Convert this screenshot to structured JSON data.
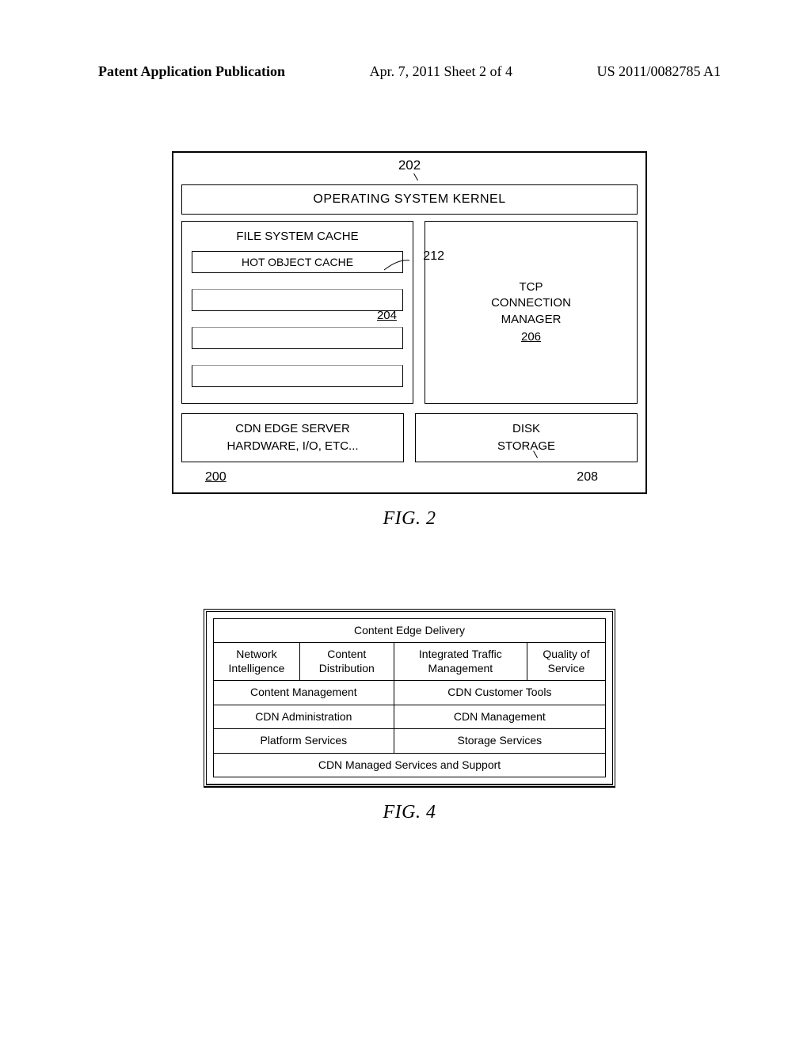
{
  "header": {
    "left": "Patent Application Publication",
    "center": "Apr. 7, 2011  Sheet 2 of 4",
    "right": "US 2011/0082785 A1"
  },
  "fig2": {
    "caption": "FIG. 2",
    "callout_202": "202",
    "os_kernel": "OPERATING SYSTEM KERNEL",
    "fsc_title": "FILE SYSTEM CACHE",
    "hot_object_cache": "HOT OBJECT CACHE",
    "callout_212": "212",
    "ref_204": "204",
    "tcp_l1": "TCP",
    "tcp_l2": "CONNECTION",
    "tcp_l3": "MANAGER",
    "ref_206": "206",
    "hw_l1": "CDN EDGE SERVER",
    "hw_l2": "HARDWARE, I/O, ETC...",
    "disk_l1": "DISK",
    "disk_l2": "STORAGE",
    "ref_200": "200",
    "ref_208": "208"
  },
  "fig4": {
    "caption": "FIG. 4",
    "r1c1": "Content Edge Delivery",
    "r2c1": "Network Intelligence",
    "r2c2": "Content Distribution",
    "r2c3": "Integrated Traffic Management",
    "r2c4": "Quality of Service",
    "r3c1": "Content Management",
    "r3c2": "CDN Customer Tools",
    "r4c1": "CDN Administration",
    "r4c2": "CDN Management",
    "r5c1": "Platform Services",
    "r5c2": "Storage Services",
    "r6c1": "CDN Managed Services and Support"
  },
  "chart_data": [
    {
      "type": "diagram",
      "title": "FIG. 2",
      "description": "Block diagram of CDN edge server architecture",
      "blocks": [
        {
          "id": "202",
          "label": "OPERATING SYSTEM KERNEL"
        },
        {
          "id": "204",
          "label": "FILE SYSTEM CACHE",
          "contains": [
            {
              "id": "212",
              "label": "HOT OBJECT CACHE"
            }
          ]
        },
        {
          "id": "206",
          "label": "TCP CONNECTION MANAGER"
        },
        {
          "id": "200",
          "label": "CDN EDGE SERVER HARDWARE, I/O, ETC..."
        },
        {
          "id": "208",
          "label": "DISK STORAGE"
        }
      ]
    },
    {
      "type": "table",
      "title": "FIG. 4",
      "description": "CDN layered services table",
      "rows": [
        [
          "Content Edge Delivery"
        ],
        [
          "Network Intelligence",
          "Content Distribution",
          "Integrated Traffic Management",
          "Quality of Service"
        ],
        [
          "Content Management",
          "CDN Customer Tools"
        ],
        [
          "CDN Administration",
          "CDN Management"
        ],
        [
          "Platform Services",
          "Storage Services"
        ],
        [
          "CDN Managed Services and Support"
        ]
      ]
    }
  ]
}
